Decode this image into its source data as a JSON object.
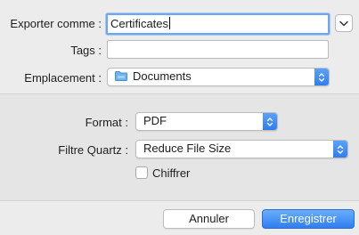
{
  "export": {
    "name_label": "Exporter comme :",
    "name_value": "Certificates",
    "tags_label": "Tags :",
    "tags_value": "",
    "location_label": "Emplacement :",
    "location_value": "Documents"
  },
  "options": {
    "format_label": "Format :",
    "format_value": "PDF",
    "quartz_label": "Filtre Quartz :",
    "quartz_value": "Reduce File Size",
    "encrypt_label": "Chiffrer",
    "encrypt_checked": false
  },
  "buttons": {
    "cancel_label": "Annuler",
    "save_label": "Enregistrer"
  },
  "colors": {
    "accent": "#2f7ef1",
    "folder": "#4fa3ea"
  }
}
